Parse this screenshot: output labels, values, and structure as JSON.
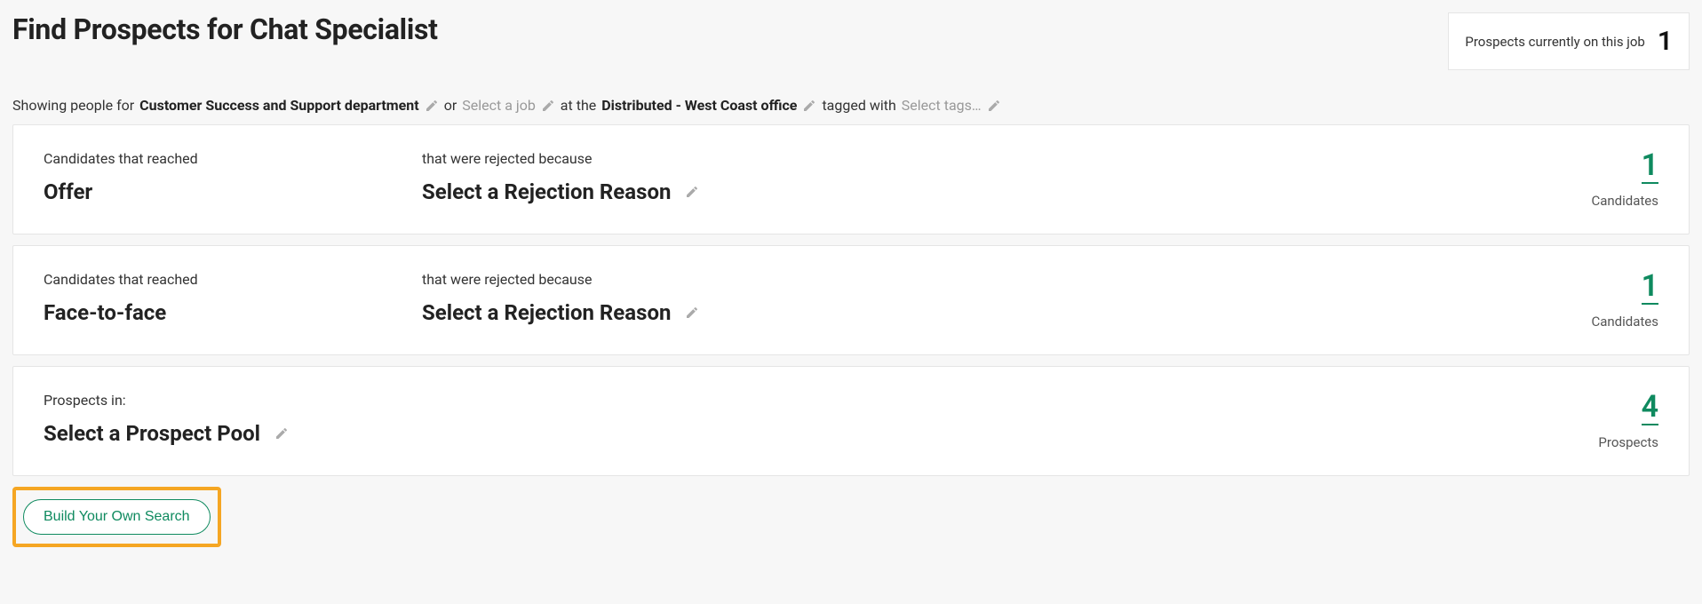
{
  "header": {
    "title": "Find Prospects for Chat Specialist"
  },
  "summary": {
    "label": "Prospects currently on this job",
    "count": "1"
  },
  "filters": {
    "prefix": "Showing people for",
    "department": "Customer Success and Support department",
    "or": "or",
    "job_placeholder": "Select a job",
    "at_the": "at the",
    "office": "Distributed - West Coast office",
    "tagged_with": "tagged with",
    "tags_placeholder": "Select tags…"
  },
  "cards": [
    {
      "stage_label": "Candidates that reached",
      "stage_value": "Offer",
      "reason_label": "that were rejected because",
      "reason_value": "Select a Rejection Reason",
      "count": "1",
      "count_label": "Candidates"
    },
    {
      "stage_label": "Candidates that reached",
      "stage_value": "Face-to-face",
      "reason_label": "that were rejected because",
      "reason_value": "Select a Rejection Reason",
      "count": "1",
      "count_label": "Candidates"
    },
    {
      "stage_label": "Prospects in:",
      "stage_value": "Select a Prospect Pool",
      "reason_label": "",
      "reason_value": "",
      "count": "4",
      "count_label": "Prospects"
    }
  ],
  "actions": {
    "build_search": "Build Your Own Search"
  }
}
